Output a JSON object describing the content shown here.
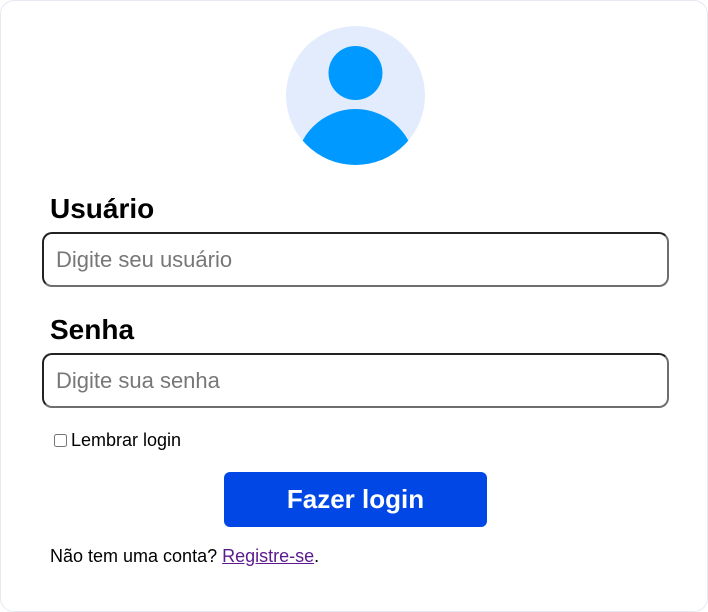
{
  "avatar": {
    "icon": "user-avatar-icon",
    "background_color": "#e3ecfd",
    "figure_color": "#0099ff"
  },
  "username": {
    "label": "Usuário",
    "placeholder": "Digite seu usuário",
    "value": ""
  },
  "password": {
    "label": "Senha",
    "placeholder": "Digite sua senha",
    "value": ""
  },
  "remember": {
    "label": "Lembrar login",
    "checked": false
  },
  "login_button": {
    "label": "Fazer login",
    "color": "#0047e6"
  },
  "register": {
    "prefix": "Não tem uma conta? ",
    "link_text": "Registre-se",
    "suffix": "."
  }
}
